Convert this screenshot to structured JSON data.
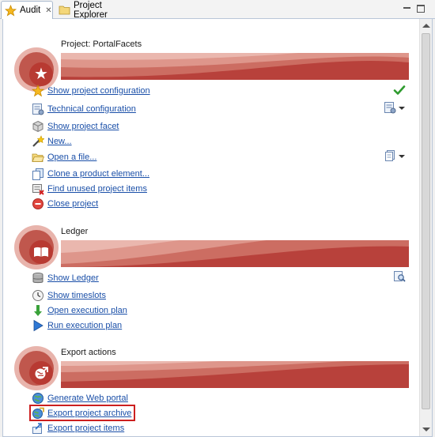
{
  "tabs": [
    {
      "label": "Audit",
      "icon": "star-icon",
      "active": true
    },
    {
      "label": "Project Explorer",
      "icon": "folder-icon",
      "active": false
    }
  ],
  "sections": [
    {
      "title": "Project: PortalFacets",
      "badge_icon": "star-icon",
      "items": [
        {
          "label": "Show project configuration",
          "icon": "star-icon"
        },
        {
          "label": "Technical configuration",
          "icon": "config-icon"
        },
        {
          "label": "Show project facet",
          "icon": "cube-icon"
        },
        {
          "label": "New...",
          "icon": "wand-icon"
        },
        {
          "label": "Open a file...",
          "icon": "folder-open-icon"
        },
        {
          "label": "Clone a product element...",
          "icon": "clone-icon"
        },
        {
          "label": "Find unused project items",
          "icon": "find-unused-icon"
        },
        {
          "label": "Close project",
          "icon": "close-circle-icon"
        }
      ]
    },
    {
      "title": "Ledger",
      "badge_icon": "book-icon",
      "items": [
        {
          "label": "Show Ledger",
          "icon": "database-icon"
        },
        {
          "label": "Show timeslots",
          "icon": "clock-icon"
        },
        {
          "label": "Open execution plan",
          "icon": "arrow-down-icon"
        },
        {
          "label": "Run execution plan",
          "icon": "play-icon"
        }
      ]
    },
    {
      "title": "Export actions",
      "badge_icon": "export-icon",
      "items": [
        {
          "label": "Generate Web portal",
          "icon": "globe-icon"
        },
        {
          "label": "Export project archive",
          "icon": "globe-export-icon",
          "highlighted": true
        },
        {
          "label": "Export project items",
          "icon": "export-items-icon"
        }
      ]
    }
  ],
  "colors": {
    "banner_dark": "#b8413b",
    "banner_mid": "#c96a60",
    "banner_light": "#e8b4ac",
    "link": "#1a4fa8",
    "highlight_border": "#cc1f1f"
  }
}
